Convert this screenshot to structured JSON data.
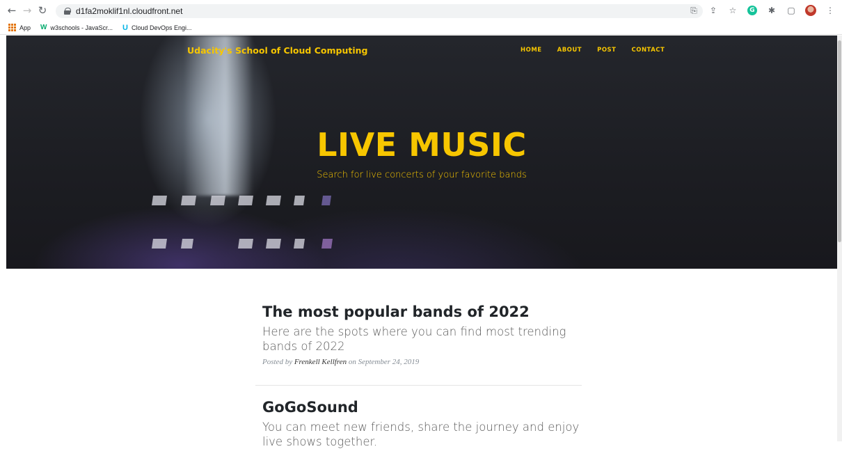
{
  "browser": {
    "url": "d1fa2moklif1nl.cloudfront.net",
    "bookmarks": [
      {
        "label": "App"
      },
      {
        "label": "w3schools - JavaScr..."
      },
      {
        "label": "Cloud DevOps Engi..."
      }
    ]
  },
  "site": {
    "brand": "Udacity's School of Cloud Computing",
    "nav": [
      "HOME",
      "ABOUT",
      "POST",
      "CONTACT"
    ],
    "hero_title": "LIVE MUSIC",
    "hero_subtitle": "Search for live concerts of your favorite bands"
  },
  "posts": [
    {
      "title": "The most popular bands of 2022",
      "subtitle": "Here are the spots where you can find most trending bands of 2022",
      "meta_prefix": "Posted by",
      "author": "Frenkell Kellfren",
      "meta_on": "on September 24, 2019"
    },
    {
      "title": "GoGoSound",
      "subtitle": "You can meet new friends, share the journey and enjoy live shows together."
    }
  ],
  "colors": {
    "accent": "#f7c600"
  }
}
